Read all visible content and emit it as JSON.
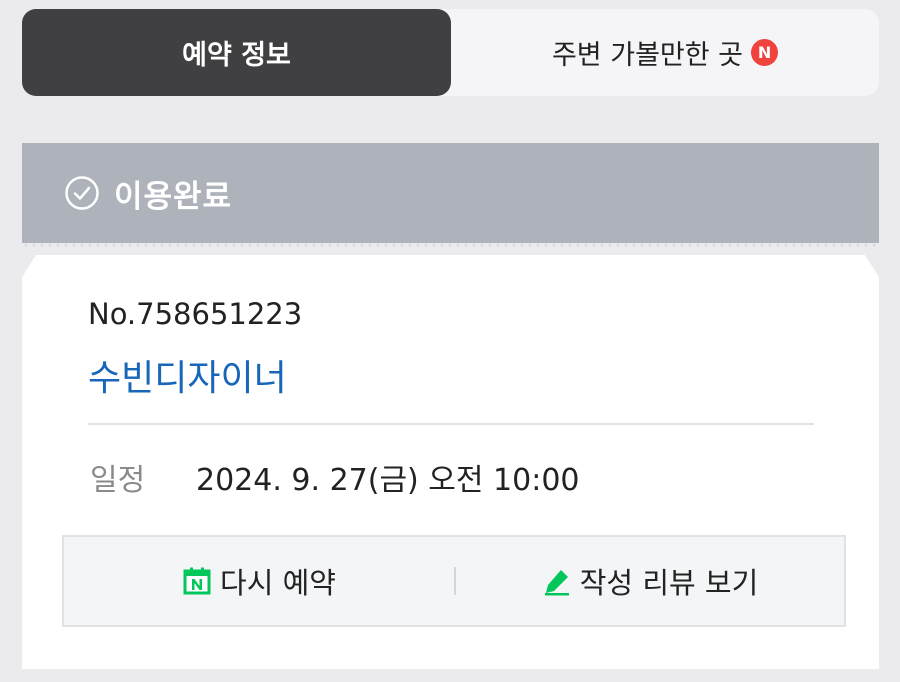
{
  "tabs": {
    "reservation_info": "예약 정보",
    "nearby_places": "주변 가볼만한 곳",
    "nearby_badge": "N"
  },
  "status": {
    "label": "이용완료",
    "icon": "check-circle-icon"
  },
  "reservation": {
    "number": "No.758651223",
    "shop_name": "수빈디자이너",
    "schedule_label": "일정",
    "schedule_value": "2024. 9. 27(금) 오전 10:00"
  },
  "actions": {
    "rebook": "다시 예약",
    "rebook_icon": "naver-calendar-icon",
    "view_review": "작성 리뷰 보기",
    "review_icon": "pencil-icon"
  },
  "colors": {
    "active_tab": "#404042",
    "status_bar": "#aeb3bb",
    "shop_link": "#1766b8",
    "naver_green": "#03c75a",
    "badge_red": "#f0433e"
  }
}
